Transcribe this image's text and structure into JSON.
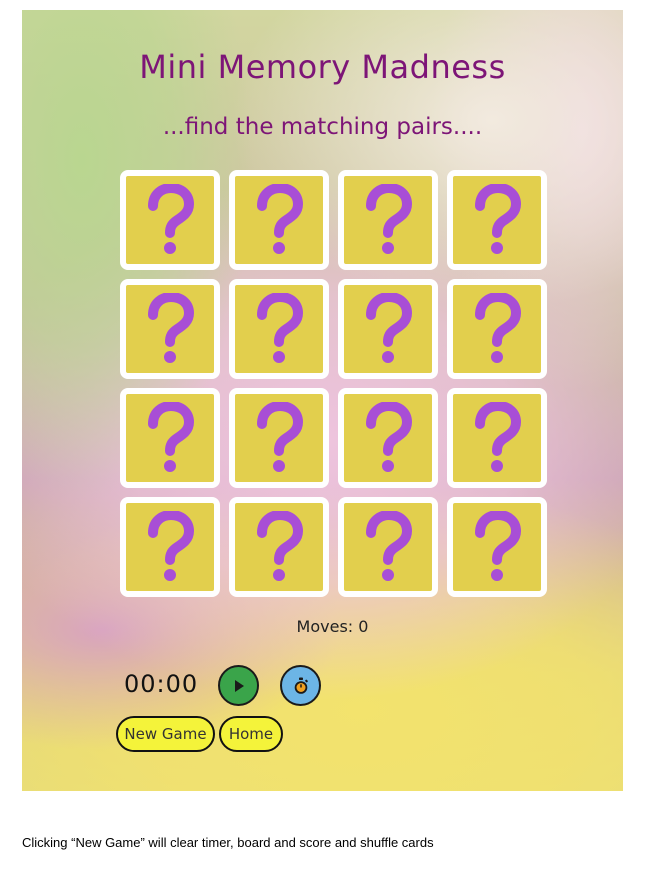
{
  "game": {
    "title": "Mini Memory Madness",
    "subtitle": "...find the matching pairs....",
    "card_face_symbol": "question-mark",
    "cards": [
      {
        "state": "face-down"
      },
      {
        "state": "face-down"
      },
      {
        "state": "face-down"
      },
      {
        "state": "face-down"
      },
      {
        "state": "face-down"
      },
      {
        "state": "face-down"
      },
      {
        "state": "face-down"
      },
      {
        "state": "face-down"
      },
      {
        "state": "face-down"
      },
      {
        "state": "face-down"
      },
      {
        "state": "face-down"
      },
      {
        "state": "face-down"
      },
      {
        "state": "face-down"
      },
      {
        "state": "face-down"
      },
      {
        "state": "face-down"
      },
      {
        "state": "face-down"
      }
    ],
    "moves_text": "Moves: 0",
    "timer": "00:00",
    "buttons": {
      "play_icon": "play-icon",
      "stopwatch_icon": "stopwatch-icon",
      "new_game": "New Game",
      "home": "Home"
    }
  },
  "caption": "Clicking “New Game” will clear timer, board and score and shuffle cards",
  "colors": {
    "title": "#7d1577",
    "card_back": "#e2cf4d",
    "question_mark": "#a84ed6",
    "play_button": "#3aa44a",
    "stopwatch_button": "#6cb5e6",
    "pill_button": "#f4f33a"
  }
}
